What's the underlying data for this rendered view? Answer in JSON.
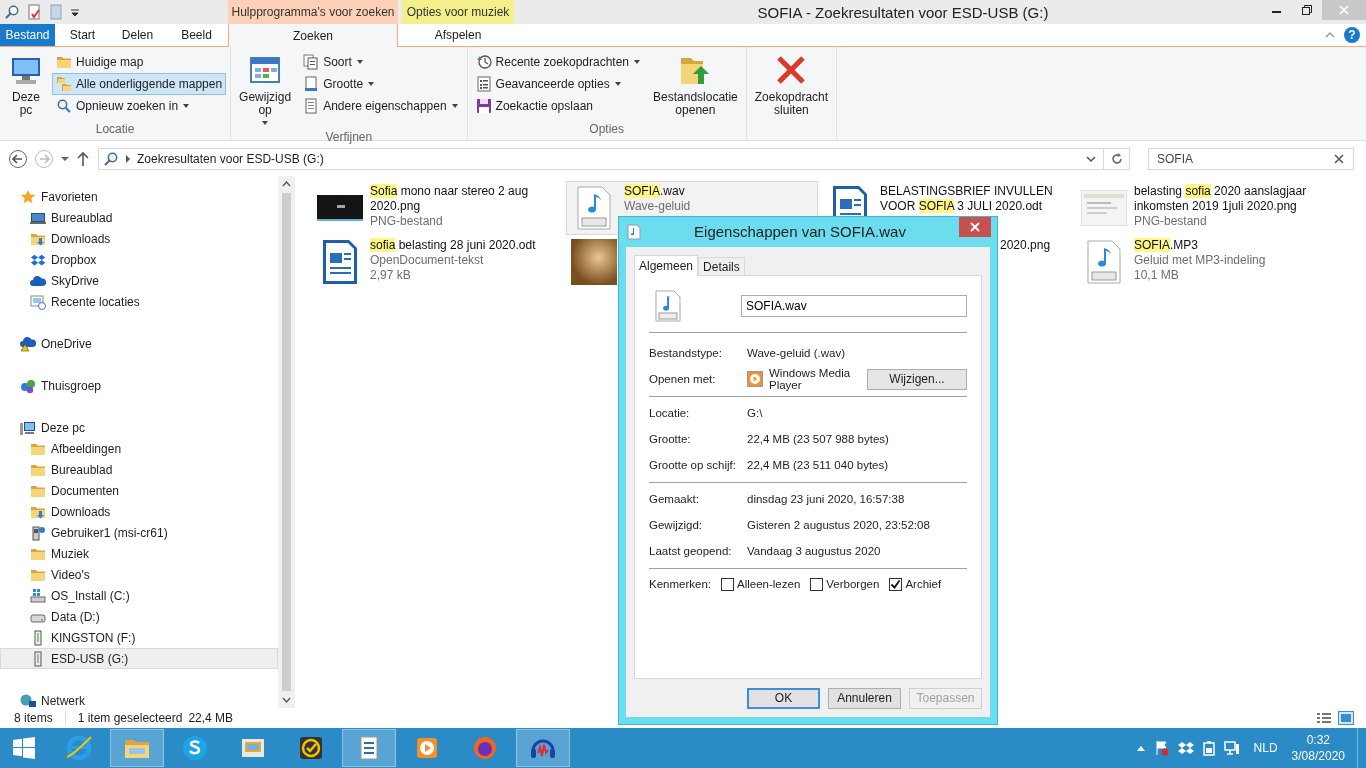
{
  "window": {
    "title": "SOFIA - Zoekresultaten voor ESD-USB (G:)",
    "help": "?"
  },
  "context_tabs": [
    {
      "label": "Hulpprogramma's voor zoeken",
      "color": "#fcd1b8"
    },
    {
      "label": "Opties voor muziek",
      "color": "#f3f08c"
    }
  ],
  "tabs": [
    {
      "label": "Bestand",
      "kind": "file",
      "selected": false
    },
    {
      "label": "Start",
      "kind": "plain",
      "selected": false
    },
    {
      "label": "Delen",
      "kind": "plain",
      "selected": false
    },
    {
      "label": "Beeld",
      "kind": "plain",
      "selected": false
    },
    {
      "label": "Zoeken",
      "kind": "context",
      "selected": true
    },
    {
      "label": "Afspelen",
      "kind": "context",
      "selected": false
    }
  ],
  "ribbon": {
    "groups": [
      {
        "label": "Locatie",
        "items": [
          {
            "label": "Deze pc",
            "kind": "large",
            "dropdown": false
          },
          {
            "label": "Huidige map",
            "kind": "small",
            "dropdown": false,
            "selected": false
          },
          {
            "label": "Alle onderliggende mappen",
            "kind": "small",
            "dropdown": false,
            "selected": true
          },
          {
            "label": "Opnieuw zoeken in",
            "kind": "small",
            "dropdown": true
          }
        ]
      },
      {
        "label": "Verfijnen",
        "items": [
          {
            "label": "Gewijzigd op",
            "kind": "large",
            "dropdown": true
          },
          {
            "label": "Soort",
            "kind": "small",
            "dropdown": true
          },
          {
            "label": "Grootte",
            "kind": "small",
            "dropdown": true
          },
          {
            "label": "Andere eigenschappen",
            "kind": "small",
            "dropdown": true
          }
        ]
      },
      {
        "label": "Opties",
        "items": [
          {
            "label": "Recente zoekopdrachten",
            "kind": "small",
            "dropdown": true
          },
          {
            "label": "Geavanceerde opties",
            "kind": "small",
            "dropdown": true
          },
          {
            "label": "Zoekactie opslaan",
            "kind": "small",
            "dropdown": false
          },
          {
            "label": "Bestandslocatie openen",
            "kind": "large",
            "dropdown": false
          }
        ]
      },
      {
        "items": [
          {
            "label": "Zoekopdracht sluiten",
            "kind": "large",
            "dropdown": false
          }
        ]
      }
    ]
  },
  "address": {
    "path": "Zoekresultaten voor ESD-USB (G:)"
  },
  "search": {
    "value": "SOFIA"
  },
  "nav": [
    {
      "label": "Favorieten",
      "kind": "star",
      "selected": false,
      "children": [
        {
          "label": "Bureaublad",
          "kind": "monitor",
          "selected": false
        },
        {
          "label": "Downloads",
          "kind": "download",
          "selected": false
        },
        {
          "label": "Dropbox",
          "kind": "dropbox",
          "selected": false
        },
        {
          "label": "SkyDrive",
          "kind": "cloud",
          "selected": false
        },
        {
          "label": "Recente locaties",
          "kind": "recent",
          "selected": false
        }
      ]
    },
    {
      "label": "OneDrive",
      "kind": "cloudwarn",
      "selected": false
    },
    {
      "label": "Thuisgroep",
      "kind": "homegroup",
      "selected": false
    },
    {
      "label": "Deze pc",
      "kind": "pc",
      "selected": false,
      "children": [
        {
          "label": "Afbeeldingen",
          "kind": "folder",
          "selected": false
        },
        {
          "label": "Bureaublad",
          "kind": "folder",
          "selected": false
        },
        {
          "label": "Documenten",
          "kind": "folder",
          "selected": false
        },
        {
          "label": "Downloads",
          "kind": "download",
          "selected": false
        },
        {
          "label": "Gebruiker1 (msi-cr61)",
          "kind": "user",
          "selected": false
        },
        {
          "label": "Muziek",
          "kind": "folder",
          "selected": false
        },
        {
          "label": "Video's",
          "kind": "folder",
          "selected": false
        },
        {
          "label": "OS_Install (C:)",
          "kind": "osdrive",
          "selected": false
        },
        {
          "label": "Data (D:)",
          "kind": "drive",
          "selected": false
        },
        {
          "label": "KINGSTON (F:)",
          "kind": "usb",
          "selected": false
        },
        {
          "label": "ESD-USB (G:)",
          "kind": "usb",
          "selected": true
        }
      ]
    },
    {
      "label": "Netwerk",
      "kind": "network",
      "selected": false
    }
  ],
  "files": [
    {
      "kind": "screenshot",
      "selected": false,
      "name_parts": [
        {
          "text": "Sofia",
          "highlight": true
        },
        {
          "text": " mono naar stereo 2 aug 2020.png",
          "highlight": false
        }
      ],
      "lines": [
        "PNG-bestand"
      ]
    },
    {
      "kind": "wav",
      "selected": true,
      "name_parts": [
        {
          "text": "SOFIA",
          "highlight": true
        },
        {
          "text": ".wav",
          "highlight": false
        }
      ],
      "lines": [
        "Wave-geluid"
      ]
    },
    {
      "kind": "odt",
      "selected": false,
      "name_parts": [
        {
          "text": "BELASTINGSBRIEF INVULLEN VOOR ",
          "highlight": false
        },
        {
          "text": "SOFIA",
          "highlight": true
        },
        {
          "text": " 3 JULI 2020.odt",
          "highlight": false
        }
      ]
    },
    {
      "kind": "webshot",
      "selected": false,
      "name_parts": [
        {
          "text": "belasting ",
          "highlight": false
        },
        {
          "text": "sofia",
          "highlight": true
        },
        {
          "text": " 2020 aanslagjaar inkomsten 2019  1juli 2020.png",
          "highlight": false
        }
      ],
      "lines": [
        "PNG-bestand"
      ]
    },
    {
      "kind": "odt",
      "selected": false,
      "name_parts": [
        {
          "text": "sofia",
          "highlight": true
        },
        {
          "text": " belasting    28 juni 2020.odt",
          "highlight": false
        }
      ],
      "lines": [
        "OpenDocument-tekst",
        "2,97 kB"
      ]
    },
    {
      "kind": "photo",
      "selected": false
    },
    {
      "kind": "covered",
      "selected": false,
      "name_parts": [
        {
          "text": "2020.png",
          "highlight": false
        }
      ]
    },
    {
      "kind": "mp3",
      "selected": false,
      "name_parts": [
        {
          "text": "SOFIA",
          "highlight": true
        },
        {
          "text": ".MP3",
          "highlight": false
        }
      ],
      "lines": [
        "Geluid met MP3-indeling",
        "10,1 MB"
      ]
    }
  ],
  "status_bar": {
    "count": "8 items",
    "selection": "1 item geselecteerd",
    "size": "22,4 MB"
  },
  "dialog": {
    "title": "Eigenschappen van SOFIA.wav",
    "tabs": [
      {
        "label": "Algemeen",
        "selected": true
      },
      {
        "label": "Details",
        "selected": false
      }
    ],
    "name": "SOFIA.wav",
    "sections": [
      [
        {
          "label": "Bestandstype:",
          "value": "Wave-geluid (.wav)"
        },
        {
          "label": "Openen met:",
          "value": "Windows Media Player",
          "button": "Wijzigen..."
        }
      ],
      [
        {
          "label": "Locatie:",
          "value": "G:\\"
        },
        {
          "label": "Grootte:",
          "value": "22,4 MB (23 507 988 bytes)"
        },
        {
          "label": "Grootte op schijf:",
          "value": "22,4 MB (23 511 040 bytes)"
        }
      ],
      [
        {
          "label": "Gemaakt:",
          "value": "dinsdag 23 juni 2020, 16:57:38"
        },
        {
          "label": "Gewijzigd:",
          "value": "Gisteren 2 augustus 2020, 23:52:08"
        },
        {
          "label": "Laatst geopend:",
          "value": "Vandaag 3 augustus 2020"
        }
      ]
    ],
    "attributes_label": "Kenmerken:",
    "attributes": [
      {
        "label": "Alleen-lezen",
        "checked": false
      },
      {
        "label": "Verborgen",
        "checked": false
      },
      {
        "label": "Archief",
        "checked": true
      }
    ],
    "buttons": [
      {
        "label": "OK",
        "default": true,
        "disabled": false
      },
      {
        "label": "Annuleren",
        "default": false,
        "disabled": false
      },
      {
        "label": "Toepassen",
        "default": false,
        "disabled": true
      }
    ]
  },
  "taskbar": {
    "apps": [
      {
        "kind": "ie",
        "open": false
      },
      {
        "kind": "explorer",
        "open": true
      },
      {
        "kind": "skype",
        "open": false
      },
      {
        "kind": "mail",
        "open": false
      },
      {
        "kind": "norton",
        "open": false
      },
      {
        "kind": "word",
        "open": true
      },
      {
        "kind": "media",
        "open": false
      },
      {
        "kind": "firefox",
        "open": false
      },
      {
        "kind": "audacity",
        "open": true
      }
    ],
    "language": "NLD",
    "time": "0:32",
    "date": "3/08/2020"
  }
}
